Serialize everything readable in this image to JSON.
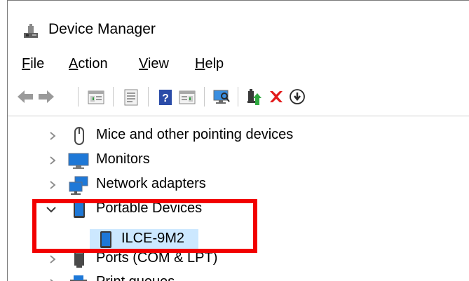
{
  "window": {
    "title": "Device Manager"
  },
  "menu": [
    {
      "label": "File",
      "accel": "F",
      "rest": "ile"
    },
    {
      "label": "Action",
      "accel": "A",
      "rest": "ction"
    },
    {
      "label": "View",
      "accel": "V",
      "rest": "iew"
    },
    {
      "label": "Help",
      "accel": "H",
      "rest": "elp"
    }
  ],
  "toolbar": {
    "buttons": [
      "back-icon",
      "forward-icon",
      "properties-pane-icon",
      "details-icon",
      "help-icon",
      "properties-icon",
      "scan-hardware-icon",
      "update-driver-icon",
      "uninstall-icon",
      "disable-icon"
    ]
  },
  "tree": {
    "items": [
      {
        "label": "Mice and other pointing devices",
        "icon": "mouse-icon",
        "expanded": false
      },
      {
        "label": "Monitors",
        "icon": "monitor-icon",
        "expanded": false
      },
      {
        "label": "Network adapters",
        "icon": "network-adapter-icon",
        "expanded": false
      },
      {
        "label": "Portable Devices",
        "icon": "portable-device-icon",
        "expanded": true
      },
      {
        "label": "ILCE-9M2",
        "icon": "portable-device-icon",
        "selected": true
      },
      {
        "label": "Ports (COM & LPT)",
        "icon": "port-icon",
        "expanded": false
      },
      {
        "label": "Print queues",
        "icon": "printer-icon",
        "expanded": false
      }
    ]
  },
  "colors": {
    "selection": "#cce8ff",
    "highlight_border": "#f20000",
    "accent_blue": "#1e78d7"
  }
}
